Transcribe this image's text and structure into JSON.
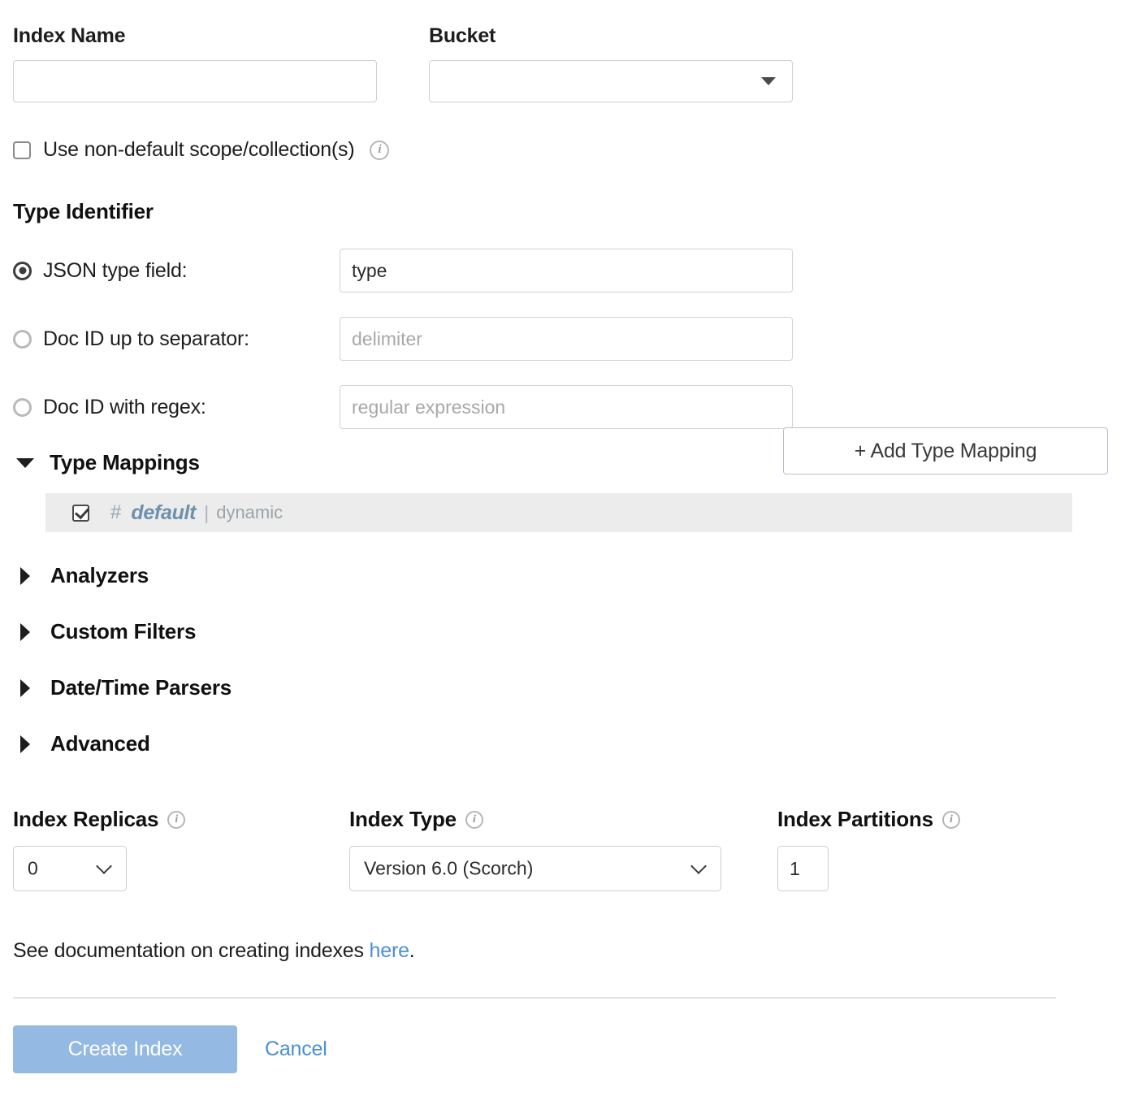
{
  "form": {
    "index_name": {
      "label": "Index Name",
      "value": "",
      "placeholder": ""
    },
    "bucket": {
      "label": "Bucket",
      "selected": "",
      "caret_icon": "caret-down-icon"
    },
    "scope_collection": {
      "label": "Use non-default scope/collection(s)",
      "checked": false,
      "info_icon": "info-icon",
      "info_glyph": "i"
    }
  },
  "type_identifier": {
    "title": "Type Identifier",
    "options": [
      {
        "label": "JSON type field:",
        "selected": true,
        "input_value": "type",
        "input_placeholder": ""
      },
      {
        "label": "Doc ID up to separator:",
        "selected": false,
        "input_value": "",
        "input_placeholder": "delimiter"
      },
      {
        "label": "Doc ID with regex:",
        "selected": false,
        "input_value": "",
        "input_placeholder": "regular expression"
      }
    ]
  },
  "type_mappings": {
    "label": "Type Mappings",
    "expanded": true,
    "add_button_label": "+ Add Type Mapping",
    "rows": [
      {
        "checked": true,
        "hash": "#",
        "name": "default",
        "separator": "|",
        "dynamic": "dynamic"
      }
    ]
  },
  "collapsed_sections": [
    {
      "label": "Analyzers",
      "expanded": false
    },
    {
      "label": "Custom Filters",
      "expanded": false
    },
    {
      "label": "Date/Time Parsers",
      "expanded": false
    },
    {
      "label": "Advanced",
      "expanded": false
    }
  ],
  "index_options": {
    "replicas": {
      "label": "Index Replicas",
      "value": "0",
      "info_glyph": "i"
    },
    "index_type": {
      "label": "Index Type",
      "value": "Version 6.0 (Scorch)",
      "info_glyph": "i"
    },
    "partitions": {
      "label": "Index Partitions",
      "value": "1",
      "info_glyph": "i"
    }
  },
  "footer": {
    "doc_text_before": "See documentation on creating indexes ",
    "doc_link_label": "here",
    "doc_text_after": ".",
    "create_label": "Create Index",
    "cancel_label": "Cancel"
  },
  "colors": {
    "primary_button": "#94b9e3",
    "link": "#4a8fd4",
    "row_highlight": "#ececec",
    "mapping_name": "#6b91ad"
  }
}
